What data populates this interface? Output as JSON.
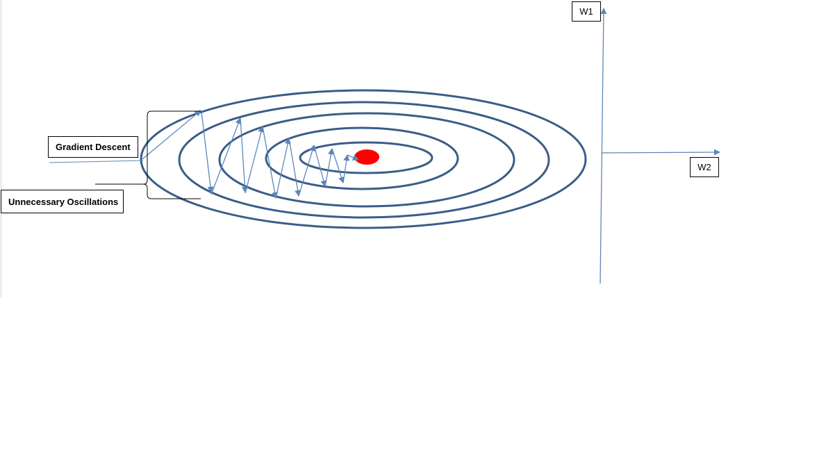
{
  "labels": {
    "gradient_descent": "Gradient Descent",
    "unnecessary_oscillations": "Unnecessary Oscillations",
    "w1": "W1",
    "w2": "W2"
  },
  "colors": {
    "contour": "#3b5c88",
    "path": "#5b86bb",
    "axis": "#5b86bb",
    "minimum": "#ff0000",
    "bracket": "#000000"
  }
}
